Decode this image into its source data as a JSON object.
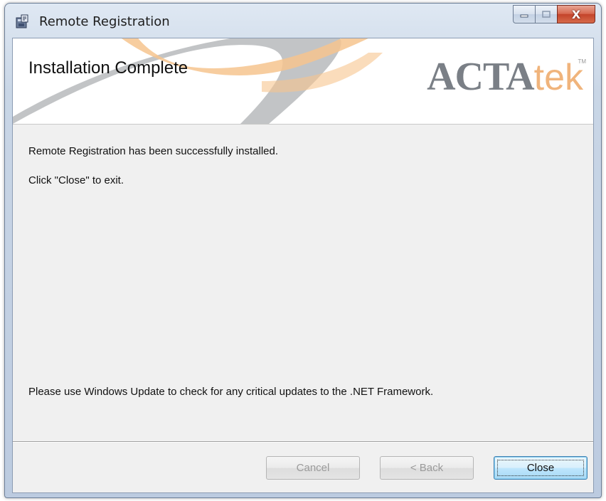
{
  "window": {
    "title": "Remote Registration",
    "app_icon": "installer-icon",
    "caption_buttons": {
      "minimize": "minimize-icon",
      "maximize": "maximize-icon",
      "close": "X"
    }
  },
  "banner": {
    "title": "Installation Complete",
    "logo": {
      "main": "ACTA",
      "sub": "tek",
      "tm": "TM"
    }
  },
  "body": {
    "line1": "Remote Registration has been successfully installed.",
    "line2": "Click \"Close\" to exit.",
    "footer_note": "Please use Windows Update to check for any critical updates to the .NET Framework."
  },
  "buttons": {
    "cancel": "Cancel",
    "back": "< Back",
    "close": "Close"
  },
  "colors": {
    "logo_gray": "#7a7f86",
    "logo_orange": "#f0b47c",
    "swoosh_orange": "#f6c48e",
    "swoosh_gray": "#8f9398"
  }
}
